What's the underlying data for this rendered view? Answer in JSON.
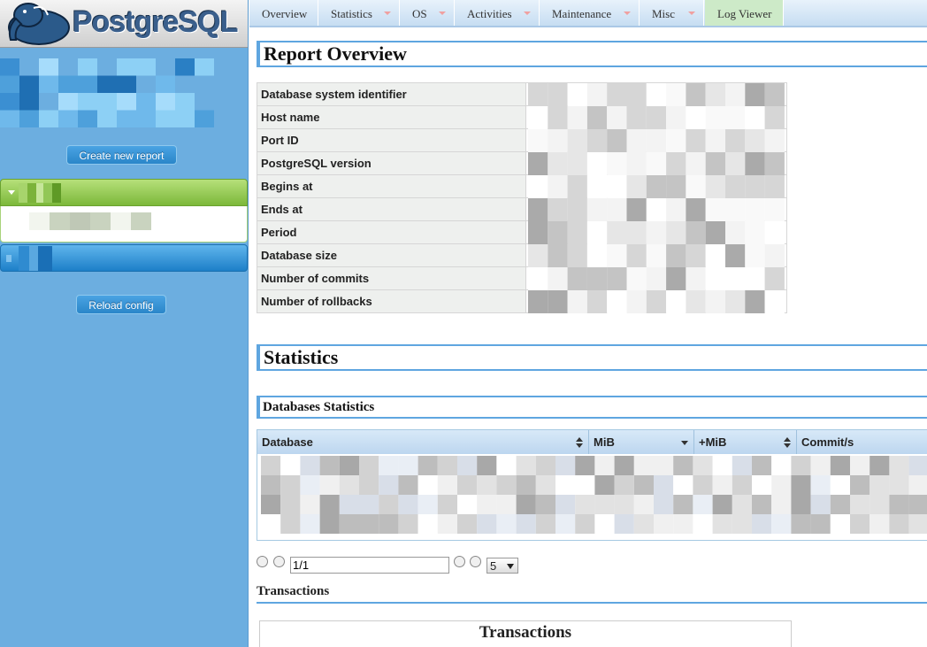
{
  "logo": {
    "text": "PostgreSQL"
  },
  "sidebar": {
    "create_button": "Create new report",
    "reload_button": "Reload config"
  },
  "menu": [
    {
      "label": "Overview",
      "has_arrow": false,
      "active": false
    },
    {
      "label": "Statistics",
      "has_arrow": true,
      "active": false
    },
    {
      "label": "OS",
      "has_arrow": true,
      "active": false
    },
    {
      "label": "Activities",
      "has_arrow": true,
      "active": false
    },
    {
      "label": "Maintenance",
      "has_arrow": true,
      "active": false
    },
    {
      "label": "Misc",
      "has_arrow": true,
      "active": false
    },
    {
      "label": "Log Viewer",
      "has_arrow": false,
      "active": true
    }
  ],
  "report_overview": {
    "title": "Report Overview",
    "rows": [
      "Database system identifier",
      "Host name",
      "Port ID",
      "PostgreSQL version",
      "Begins at",
      "Ends at",
      "Period",
      "Database size",
      "Number of commits",
      "Number of rollbacks"
    ]
  },
  "statistics": {
    "title": "Statistics",
    "databases_title": "Databases Statistics",
    "columns": [
      "Database",
      "MiB",
      "+MiB",
      "Commit/s"
    ],
    "pager": {
      "page": "1/1",
      "page_size": "5"
    }
  },
  "transactions": {
    "heading": "Transactions",
    "chart_title": "Transactions"
  },
  "colors": {
    "sidebar_bg": "#6caee0",
    "heading_border": "#5fa6e0",
    "accordion_green": "#7cb83a",
    "accordion_blue": "#1d7fc8",
    "active_tab": "#cdeac8"
  }
}
